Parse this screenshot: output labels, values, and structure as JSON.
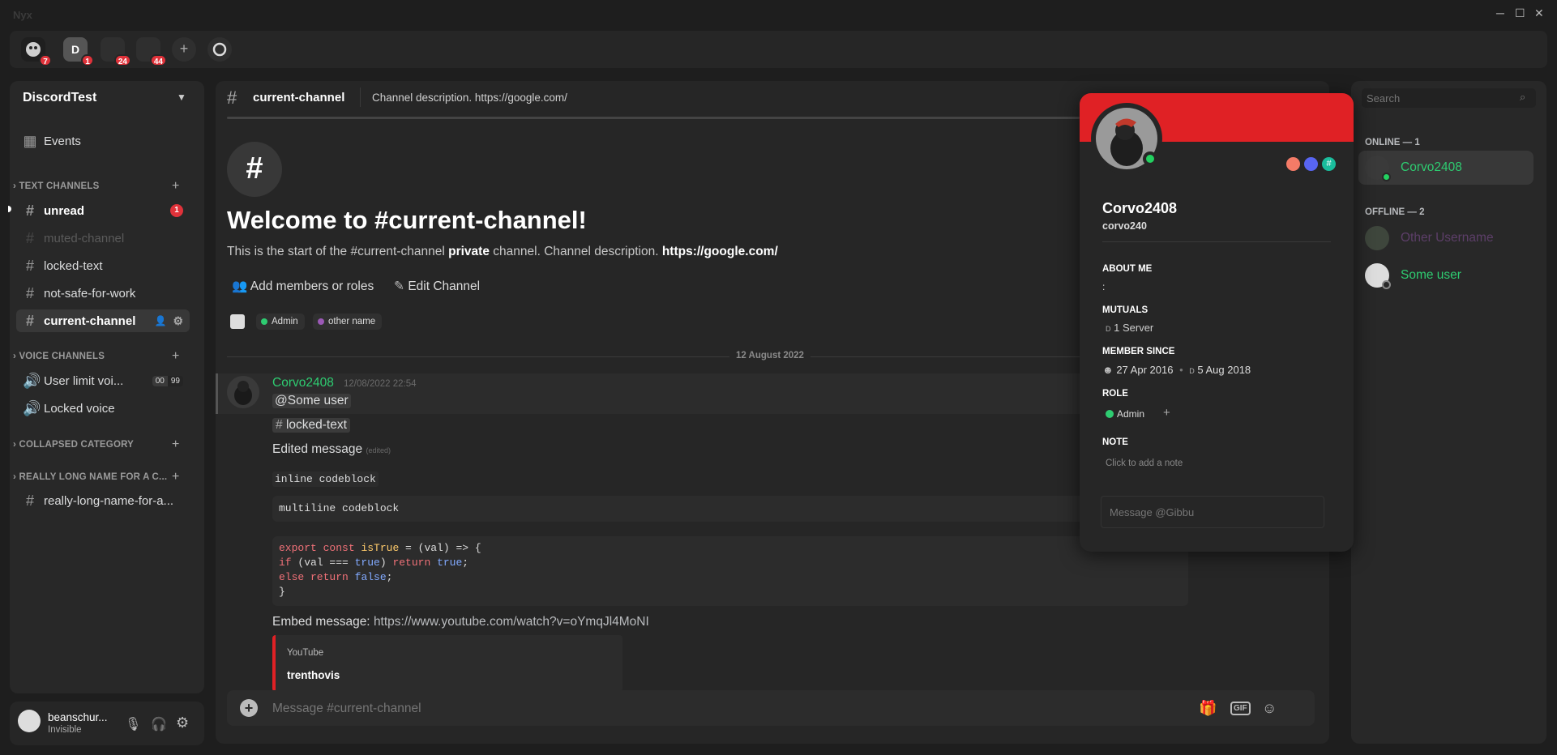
{
  "app": {
    "title": "Nyx"
  },
  "window_controls": {
    "minimize": "─",
    "maximize": "☐",
    "close": "✕"
  },
  "servers": [
    {
      "badge": "7"
    },
    {
      "initial": "D",
      "badge": "1"
    },
    {
      "badge": "24"
    },
    {
      "badge": "44"
    }
  ],
  "sidebar": {
    "guild_name": "DiscordTest",
    "events_label": "Events",
    "text_category": "TEXT CHANNELS",
    "voice_category": "VOICE CHANNELS",
    "collapsed_category": "COLLAPSED CATEGORY",
    "long_category": "REALLY LONG NAME FOR A C...",
    "channels": [
      {
        "name": "unread",
        "badge": "1"
      },
      {
        "name": "muted-channel"
      },
      {
        "name": "locked-text"
      },
      {
        "name": "not-safe-for-work"
      },
      {
        "name": "current-channel"
      }
    ],
    "voice_channels": [
      {
        "name": "User limit voi...",
        "count1": "00",
        "count2": "99"
      },
      {
        "name": "Locked voice"
      }
    ],
    "long_channel": "really-long-name-for-a..."
  },
  "user": {
    "name": "beanschur...",
    "status": "Invisible"
  },
  "chat": {
    "channel_name": "current-channel",
    "description": "Channel description. https://google.com/",
    "welcome_title": "Welcome to #current-channel!",
    "welcome_prefix": "This is the start of the #current-channel",
    "welcome_bold": "private",
    "welcome_mid": "channel. Channel description.",
    "welcome_link": "https://google.com/",
    "add_members": "Add members or roles",
    "edit_channel": "Edit Channel",
    "roles": [
      {
        "name": "Admin",
        "color": "#2ecc71"
      },
      {
        "name": "other name",
        "color": "#9b59b6"
      }
    ],
    "date_divider": "12 August 2022",
    "message": {
      "author": "Corvo2408",
      "timestamp": "12/08/2022 22:54",
      "mention": "@Some user",
      "channel_mention": "locked-text",
      "edited_text": "Edited message",
      "edited_tag": "(edited)",
      "inline_code": "inline codeblock",
      "multiline_code": "multiline codeblock",
      "code_lines": [
        "export const isTrue = (val) => {",
        "if (val === true) return true;",
        "else return false;",
        "}"
      ],
      "embed_prefix": "Embed message:",
      "embed_link": "https://www.youtube.com/watch?v=oYmqJl4MoNI",
      "embed_provider": "YouTube",
      "embed_title": "trenthovis"
    },
    "input_placeholder": "Message #current-channel",
    "gif_label": "GIF"
  },
  "profile": {
    "display_name": "Corvo2408",
    "username": "corvo240",
    "about_label": "ABOUT ME",
    "about_text": ":",
    "mutuals_label": "MUTUALS",
    "mutuals_value": "1 Server",
    "member_since_label": "MEMBER SINCE",
    "since_discord": "27 Apr 2016",
    "since_server": "5 Aug 2018",
    "role_label": "ROLE",
    "role_name": "Admin",
    "note_label": "NOTE",
    "note_placeholder": "Click to add a note",
    "message_placeholder": "Message @Gibbu",
    "banner_color": "#e02125"
  },
  "members": {
    "search_placeholder": "Search",
    "online_label": "ONLINE — 1",
    "offline_label": "OFFLINE — 2",
    "online": [
      {
        "name": "Corvo2408"
      }
    ],
    "offline": [
      {
        "name": "Other Username"
      },
      {
        "name": "Some user"
      }
    ]
  }
}
